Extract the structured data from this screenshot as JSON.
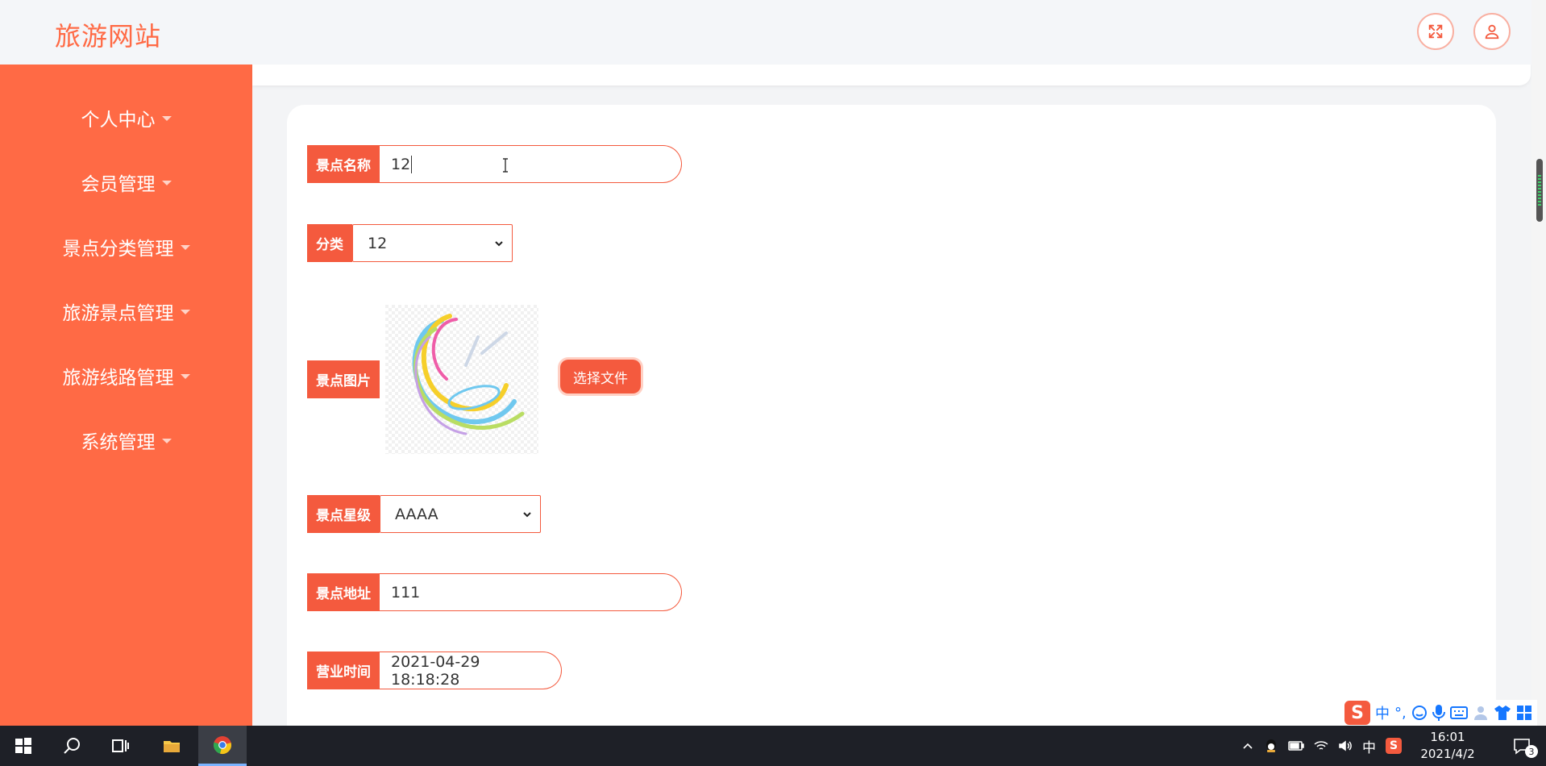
{
  "header": {
    "brand": "旅游网站"
  },
  "sidebar": {
    "items": [
      {
        "label": "个人中心"
      },
      {
        "label": "会员管理"
      },
      {
        "label": "景点分类管理"
      },
      {
        "label": "旅游景点管理"
      },
      {
        "label": "旅游线路管理"
      },
      {
        "label": "系统管理"
      }
    ]
  },
  "form": {
    "name": {
      "label": "景点名称",
      "value": "12"
    },
    "category": {
      "label": "分类",
      "selected": "12"
    },
    "image": {
      "label": "景点图片",
      "button": "选择文件"
    },
    "level": {
      "label": "景点星级",
      "selected": "AAAA"
    },
    "address": {
      "label": "景点地址",
      "value": "111"
    },
    "hours": {
      "label": "营业时间",
      "value": "2021-04-29 18:18:28"
    }
  },
  "ime": {
    "mode": "中",
    "punct": "°,"
  },
  "taskbar": {
    "tray_lang": "中",
    "time": "16:01",
    "date": "2021/4/2",
    "notification_count": "3"
  },
  "colors": {
    "accent": "#ff6a45",
    "label_bg": "#f45a3e",
    "border": "#f45a3e"
  }
}
